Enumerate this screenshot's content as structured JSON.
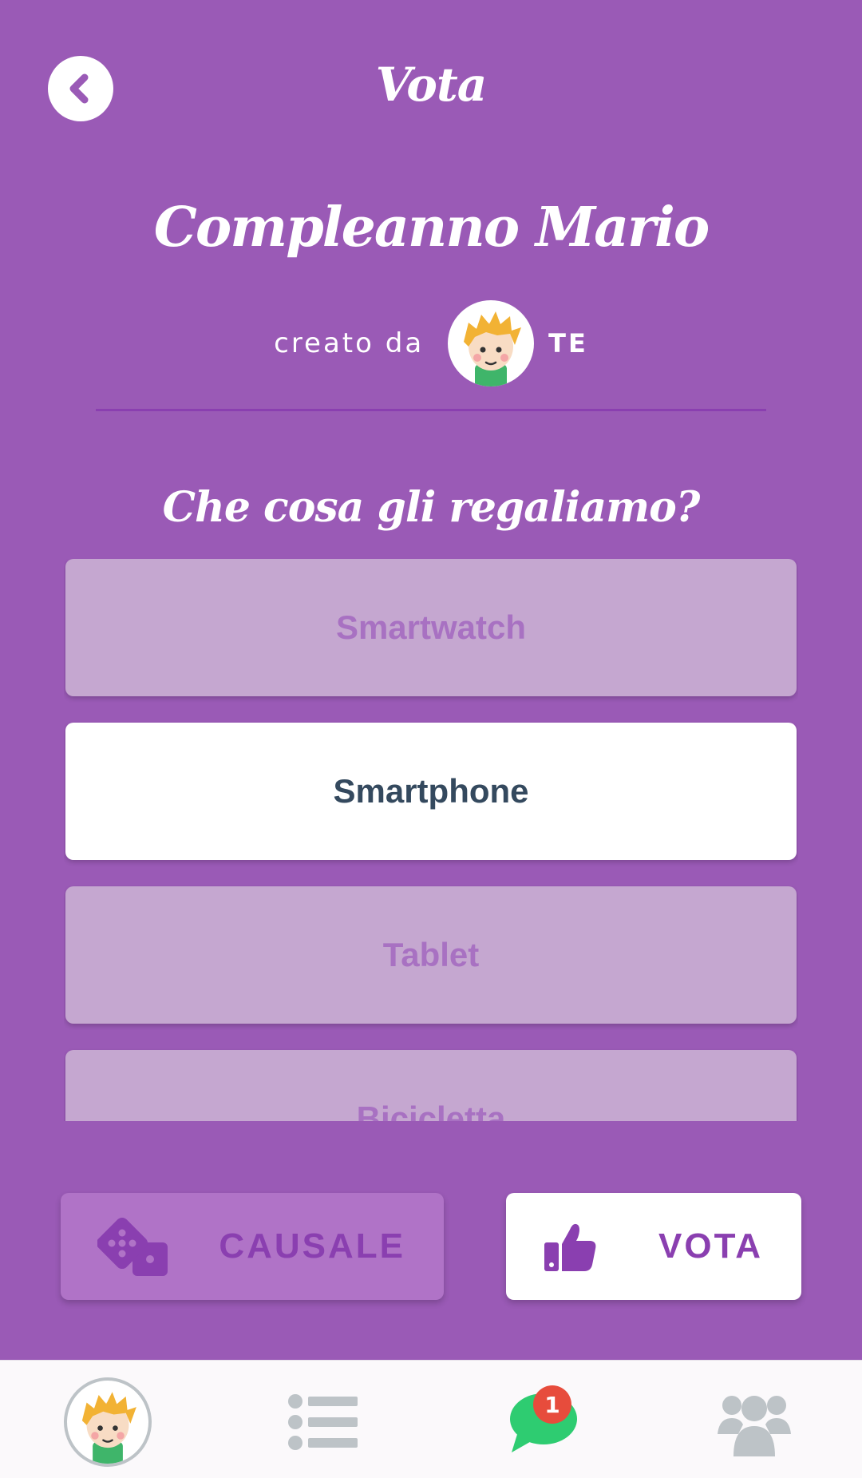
{
  "header": {
    "title": "Vota",
    "back_icon": "chevron-left-icon"
  },
  "event": {
    "title": "Compleanno Mario",
    "created_by_label": "creato da",
    "creator_name": "TE",
    "creator_avatar_icon": "boy-avatar-icon"
  },
  "poll": {
    "question": "Che cosa gli regaliamo?",
    "options": [
      {
        "label": "Smartwatch",
        "selected": false
      },
      {
        "label": "Smartphone",
        "selected": true
      },
      {
        "label": "Tablet",
        "selected": false
      },
      {
        "label": "Bicicletta",
        "selected": false
      }
    ]
  },
  "actions": {
    "random_label": "CAUSALE",
    "random_icon": "dice-icon",
    "vote_label": "VOTA",
    "vote_icon": "thumbs-up-icon"
  },
  "nav": {
    "profile_icon": "boy-avatar-icon",
    "list_icon": "list-icon",
    "chat_icon": "chat-bubble-icon",
    "chat_badge": "1",
    "group_icon": "users-icon"
  },
  "colors": {
    "background": "#9a5ab6",
    "accent": "#8a3fb0",
    "option_dim": "#c5a7d0",
    "option_text_dim": "#a871c2",
    "option_text_selected": "#34495e",
    "chat_green": "#2ecc71",
    "badge_red": "#e74c3c",
    "nav_gray": "#bdc3c7"
  }
}
